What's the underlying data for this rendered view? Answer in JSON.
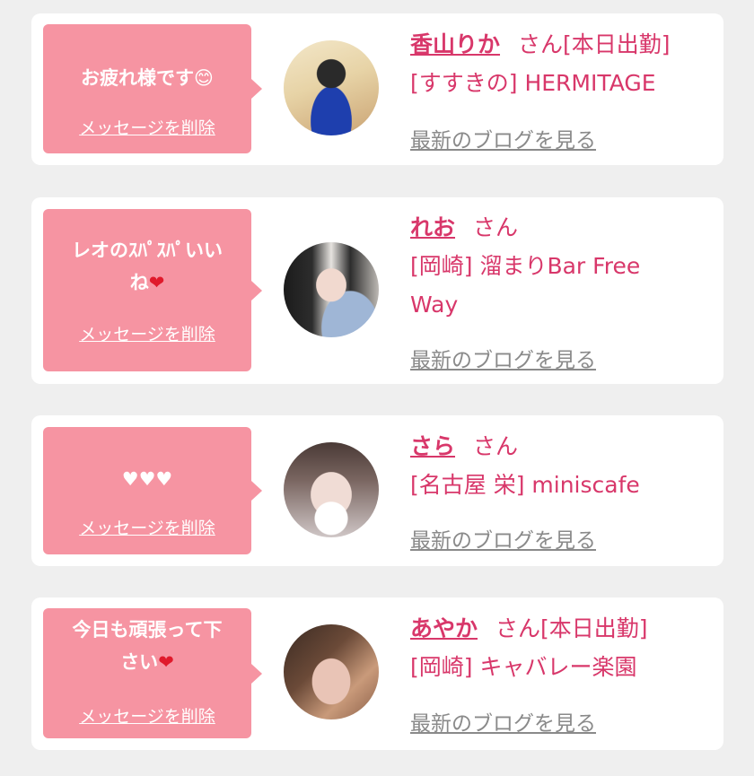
{
  "colors": {
    "accent": "#d8376a",
    "bubble": "#f694a2",
    "background": "#efefef",
    "link_gray": "#8a8a8a"
  },
  "delete_label": "メッセージを削除",
  "blog_label": "最新のブログを見る",
  "cards": [
    {
      "message": "お疲れ様です",
      "emoji": "😊",
      "name": "香山りか",
      "suffix": "さん[本日出勤]",
      "shop": "[すすきの] HERMITAGE"
    },
    {
      "message_line1": "レオのｽﾊﾟｽﾊﾟいい",
      "message_line2": "ね",
      "emoji": "❤",
      "name": "れお",
      "suffix": "さん",
      "shop_line1": "[岡崎] 溜まりBar Free",
      "shop_line2": "Way"
    },
    {
      "message": "♥♥♥",
      "name": "さら",
      "suffix": "さん",
      "shop": "[名古屋 栄] miniscafe"
    },
    {
      "message_line1": "今日も頑張って下",
      "message_line2": "さい",
      "emoji": "❤",
      "name": "あやか",
      "suffix": "さん[本日出勤]",
      "shop": "[岡崎] キャバレー楽園"
    }
  ]
}
